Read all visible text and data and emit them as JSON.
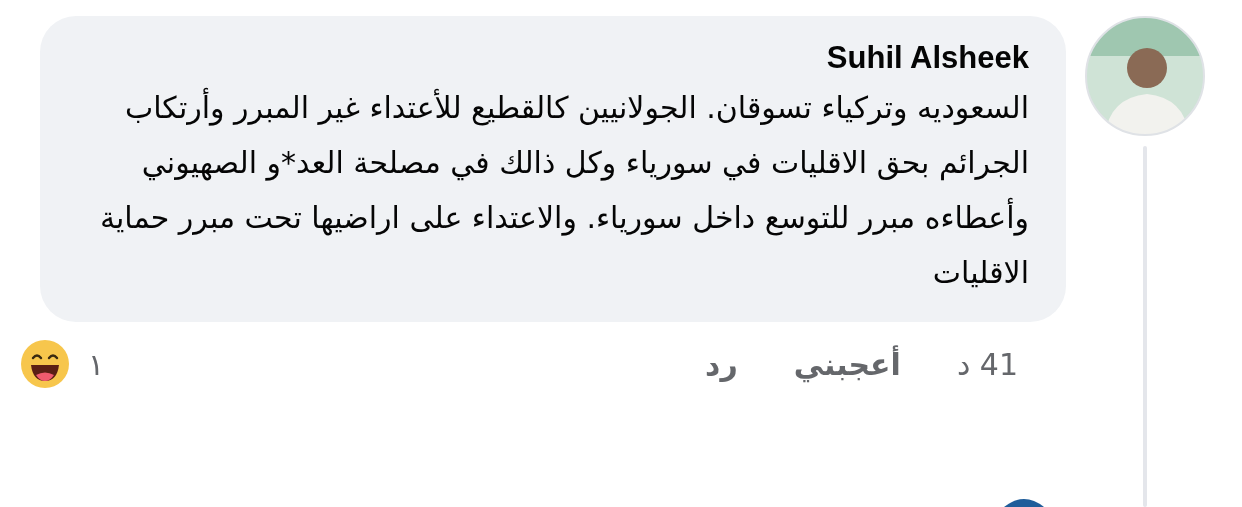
{
  "comment": {
    "author": "Suhil Alsheek",
    "text": "السعوديه وتركياء تسوقان. الجولانيين كالقطيع للأعتداء غير المبرر وأرتكاب الجرائم بحق الاقليات في سورياء وكل ذالك في مصلحة العد*و الصهيوني وأعطاءه مبرر للتوسع داخل سورياء. والاعتداء على اراضيها تحت مبرر حماية الاقليات",
    "time": "41 د",
    "actions": [
      "أعجبني",
      "رد"
    ],
    "reaction_count": "١"
  }
}
